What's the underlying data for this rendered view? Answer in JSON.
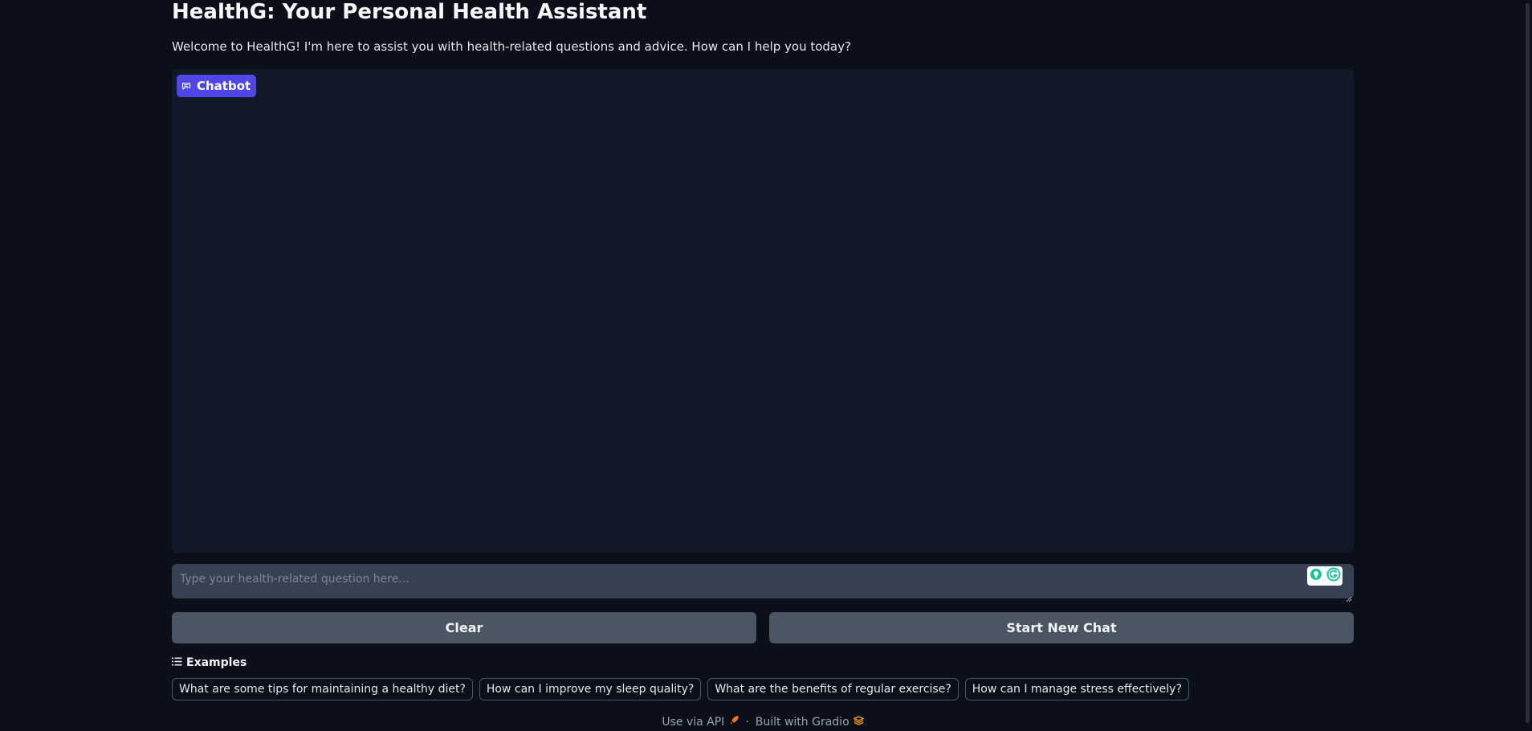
{
  "header": {
    "title": "HealthG: Your Personal Health Assistant",
    "description": "Welcome to HealthG! I'm here to assist you with health-related questions and advice. How can I help you today?"
  },
  "chatbot": {
    "label": "Chatbot",
    "icon": "chat-bubble-icon",
    "accent_color": "#4f46e5",
    "messages": []
  },
  "input": {
    "value": "",
    "placeholder": "Type your health-related question here..."
  },
  "buttons": {
    "clear_label": "Clear",
    "new_chat_label": "Start New Chat"
  },
  "examples": {
    "heading": "Examples",
    "items": [
      "What are some tips for maintaining a healthy diet?",
      "How can I improve my sleep quality?",
      "What are the benefits of regular exercise?",
      "How can I manage stress effectively?"
    ]
  },
  "footer": {
    "api_label": "Use via API",
    "separator": "·",
    "built_with_label": "Built with Gradio"
  },
  "colors": {
    "background": "#0b0f19",
    "panel": "#111827",
    "input": "#374151",
    "button": "#4b5563"
  }
}
